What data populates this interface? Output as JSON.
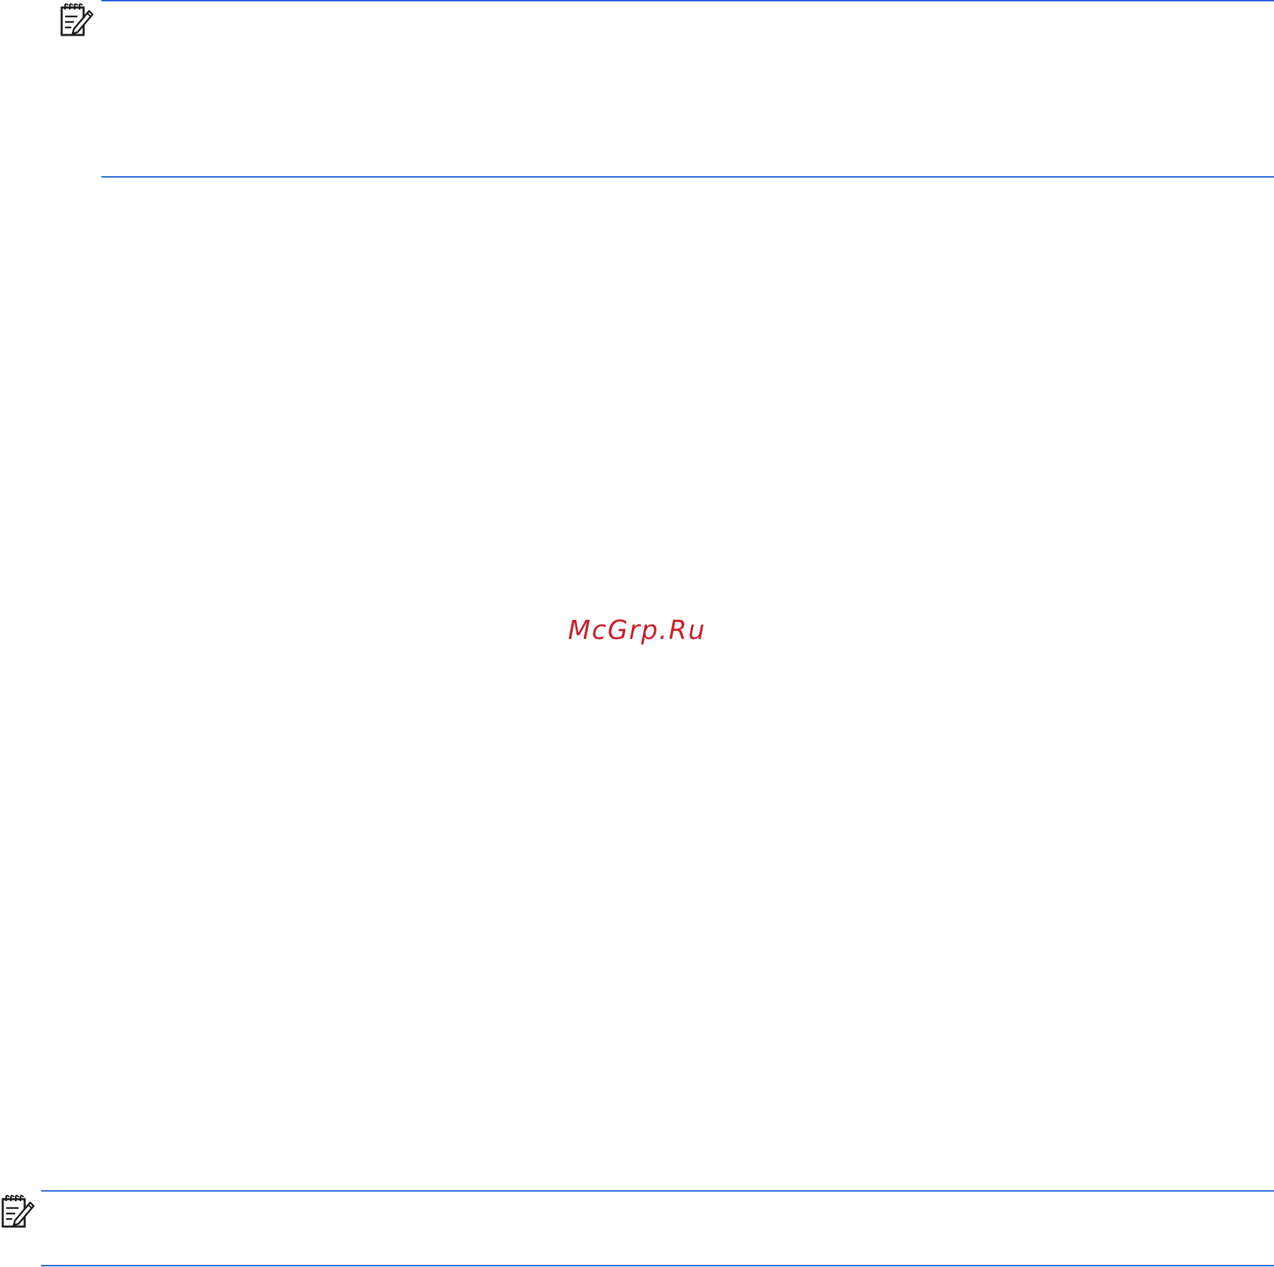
{
  "notes": [
    {
      "icon": "note-pencil-icon"
    },
    {
      "icon": "note-pencil-icon"
    }
  ],
  "watermark": {
    "text": "McGrp.Ru"
  },
  "colors": {
    "rule": "#1c5fd6",
    "icon": "#1a1a1a",
    "watermark": "#c8202a"
  }
}
